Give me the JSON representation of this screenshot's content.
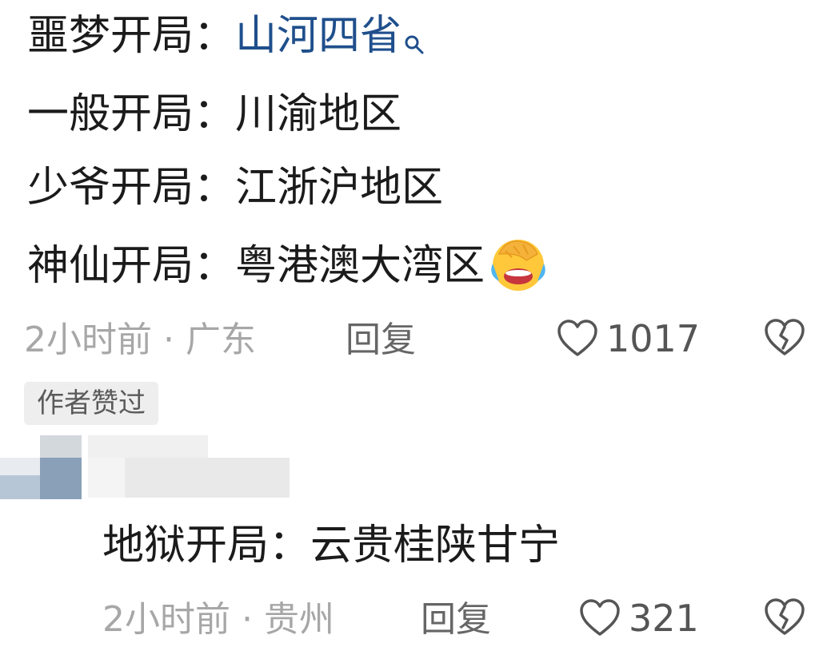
{
  "comment1": {
    "lines": [
      {
        "prefix": "噩梦开局：",
        "value": "山河四省",
        "highlight": true
      },
      {
        "prefix": "一般开局：",
        "value": "川渝地区"
      },
      {
        "prefix": "少爷开局：",
        "value": "江浙沪地区"
      },
      {
        "prefix": "神仙开局：",
        "value": "粤港澳大湾区",
        "emoji": "face-palm-laughing-crying-emoji"
      }
    ],
    "time": "2小时前",
    "separator": "·",
    "location": "广东",
    "reply_label": "回复",
    "likes": "1017",
    "badge": "作者赞过"
  },
  "comment2": {
    "text_prefix": "地狱开局：",
    "text_value": "云贵桂陕甘宁",
    "time": "2小时前",
    "separator": "·",
    "location": "贵州",
    "reply_label": "回复",
    "likes": "321"
  },
  "colors": {
    "link": "#1f4f8c",
    "meta": "#a7a7a7",
    "badge_bg": "#eeeeee"
  },
  "icons": [
    "search-icon",
    "heart-icon",
    "broken-heart-icon"
  ]
}
